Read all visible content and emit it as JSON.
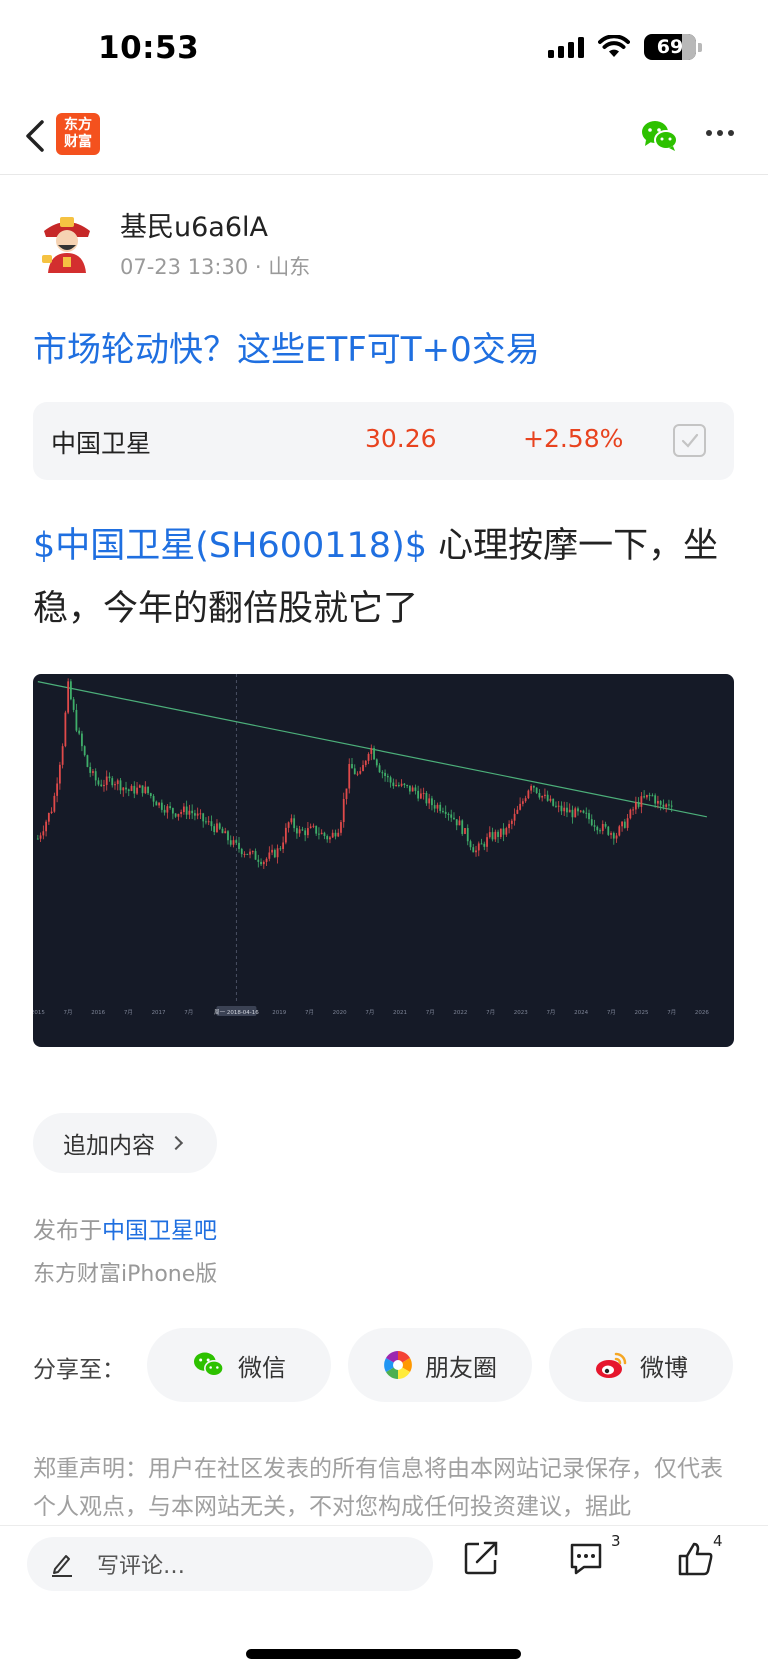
{
  "status_bar": {
    "time": "10:53",
    "battery": "69"
  },
  "nav": {
    "logo_line1": "东方",
    "logo_line2": "财富"
  },
  "author": {
    "name": "基民u6a6lA",
    "meta": "07-23 13:30 · 山东"
  },
  "post": {
    "title": "市场轮动快？这些ETF可T+0交易",
    "stock_card": {
      "name": "中国卫星",
      "price": "30.26",
      "change": "+2.58%"
    },
    "body_stock": "$中国卫星(SH600118)$",
    "body_text": " 心理按摩一下，坐稳，今年的翻倍股就它了"
  },
  "chart_data": {
    "type": "line",
    "title": "",
    "x_tick_labels": [
      "2015",
      "7月",
      "2016",
      "7月",
      "2017",
      "7月",
      "周一 2018-04-16",
      "2019",
      "7月",
      "2020",
      "7月",
      "2021",
      "7月",
      "2022",
      "7月",
      "2023",
      "7月",
      "2024",
      "7月",
      "2025",
      "7月",
      "2026"
    ],
    "crosshair_label": "周一 2018-04-16",
    "series": [
      {
        "x": [
          "2015-01",
          "2015-04",
          "2015-06",
          "2015-07",
          "2015-09",
          "2015-11",
          "2016-01",
          "2016-04",
          "2016-07",
          "2016-10",
          "2017-01",
          "2017-04",
          "2017-07",
          "2017-10",
          "2018-01",
          "2018-04",
          "2018-07",
          "2018-10",
          "2019-01",
          "2019-03",
          "2019-05",
          "2019-08",
          "2019-11",
          "2020-01",
          "2020-02",
          "2020-03",
          "2020-05",
          "2020-07",
          "2020-09",
          "2020-11",
          "2021-01",
          "2021-04",
          "2021-07",
          "2021-10",
          "2022-01",
          "2022-04",
          "2022-07",
          "2022-10",
          "2023-01",
          "2023-03",
          "2023-05",
          "2023-08",
          "2023-11",
          "2024-02",
          "2024-05",
          "2024-08",
          "2024-10",
          "2024-12",
          "2025-03",
          "2025-05",
          "2025-07"
        ],
        "values": [
          0.3,
          0.45,
          0.75,
          1.0,
          0.78,
          0.62,
          0.55,
          0.57,
          0.52,
          0.53,
          0.46,
          0.42,
          0.43,
          0.38,
          0.34,
          0.27,
          0.23,
          0.2,
          0.25,
          0.38,
          0.33,
          0.34,
          0.3,
          0.36,
          0.5,
          0.63,
          0.58,
          0.73,
          0.62,
          0.56,
          0.54,
          0.52,
          0.46,
          0.44,
          0.36,
          0.24,
          0.31,
          0.33,
          0.45,
          0.56,
          0.5,
          0.44,
          0.42,
          0.4,
          0.35,
          0.32,
          0.38,
          0.46,
          0.5,
          0.44,
          0.47
        ]
      }
    ],
    "trendline": {
      "from": [
        "2015-01",
        1.02
      ],
      "to": [
        "2026-02",
        0.4
      ]
    },
    "grid": false
  },
  "actions": {
    "add_content": "追加内容"
  },
  "published": {
    "prefix": "发布于",
    "forum": "中国卫星吧",
    "client": "东方财富iPhone版"
  },
  "share": {
    "label": "分享至：",
    "wechat": "微信",
    "moments": "朋友圈",
    "weibo": "微博"
  },
  "disclaimer": "郑重声明：用户在社区发表的所有信息将由本网站记录保存，仅代表个人观点，与本网站无关，不对您构成任何投资建议，据此",
  "bottom_bar": {
    "comment_placeholder": "写评论…",
    "comment_count": "3",
    "like_count": "4"
  },
  "colors": {
    "accent_blue": "#1f6fe0",
    "stock_red": "#e8431f",
    "chart_bg": "#151a27",
    "trend_green": "#4caf7a"
  }
}
